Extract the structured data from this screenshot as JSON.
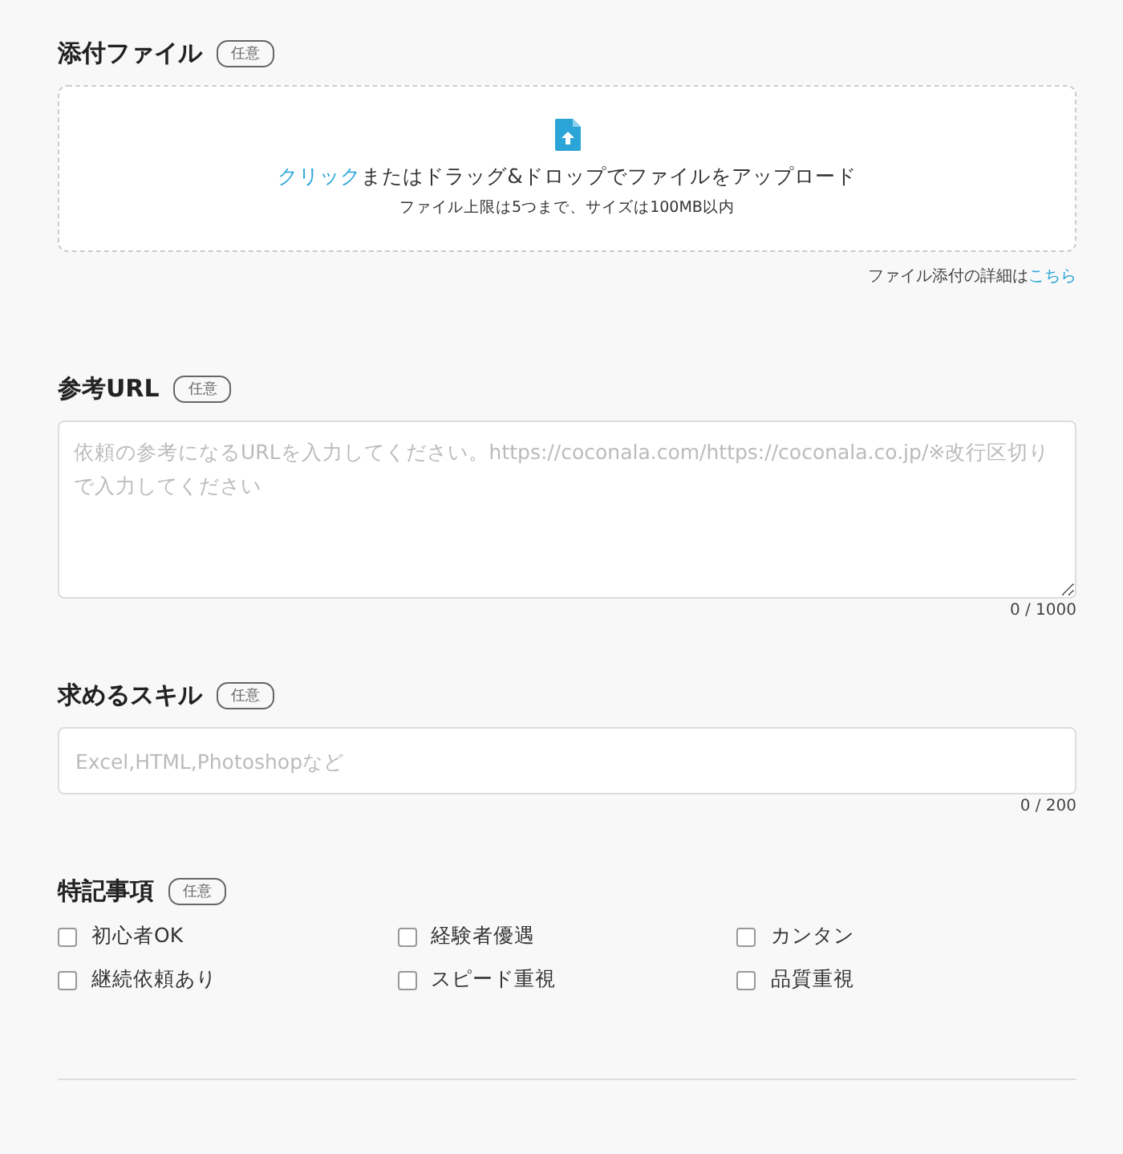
{
  "attachment": {
    "title": "添付ファイル",
    "badge": "任意",
    "dropzone": {
      "link": "クリック",
      "text": "またはドラッグ&ドロップでファイルをアップロード",
      "note": "ファイル上限は5つまで、サイズは100MB以内"
    },
    "details": {
      "text": "ファイル添付の詳細は",
      "link": "こちら"
    }
  },
  "reference_url": {
    "title": "参考URL",
    "badge": "任意",
    "placeholder": "依頼の参考になるURLを入力してください。https://coconala.com/https://coconala.co.jp/※改行区切りで入力してください",
    "counter": "0 / 1000"
  },
  "skills": {
    "title": "求めるスキル",
    "badge": "任意",
    "placeholder": "Excel,HTML,Photoshopなど",
    "counter": "0 / 200"
  },
  "notes": {
    "title": "特記事項",
    "badge": "任意",
    "options": [
      {
        "label": "初心者OK",
        "checked": false
      },
      {
        "label": "経験者優遇",
        "checked": false
      },
      {
        "label": "カンタン",
        "checked": false
      },
      {
        "label": "継続依頼あり",
        "checked": false
      },
      {
        "label": "スピード重視",
        "checked": false
      },
      {
        "label": "品質重視",
        "checked": false
      }
    ]
  }
}
